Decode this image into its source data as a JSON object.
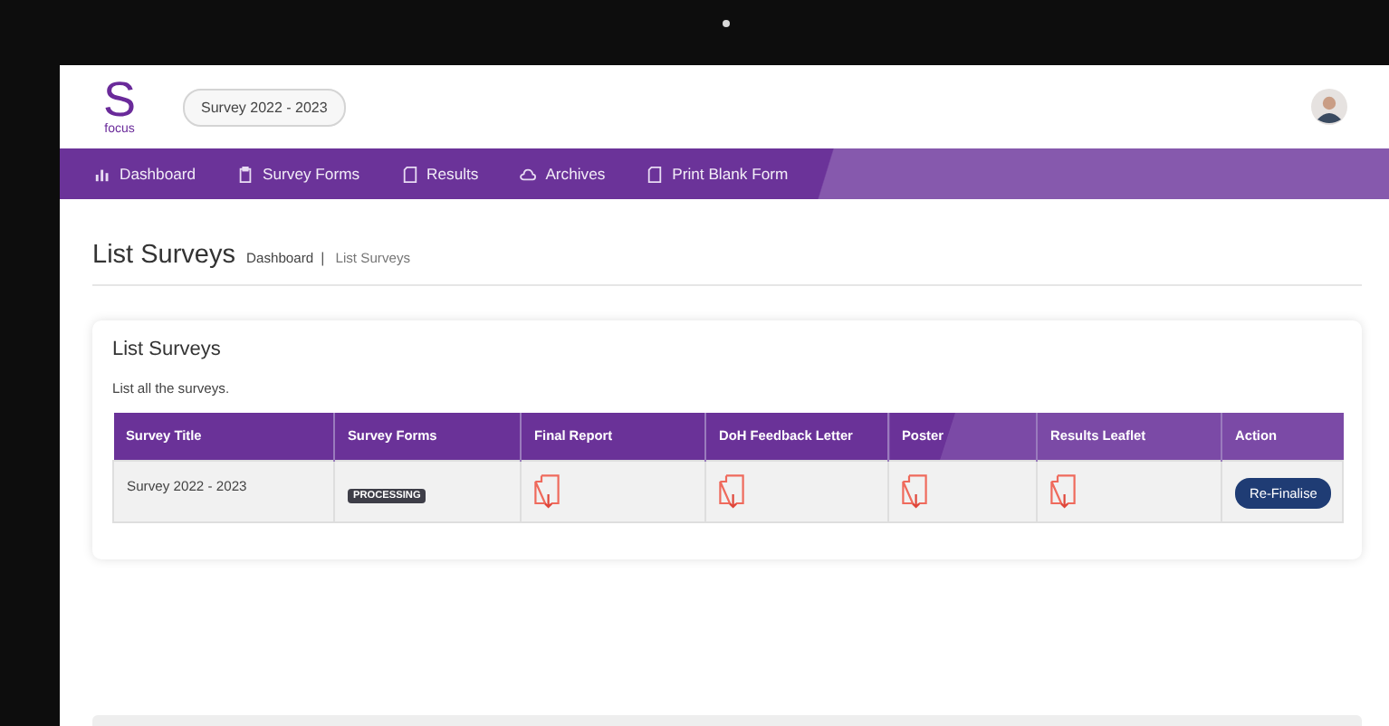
{
  "header": {
    "logo": {
      "letter": "S",
      "caption": "focus"
    },
    "survey_selector": "Survey 2022 - 2023"
  },
  "nav": [
    {
      "label": "Dashboard",
      "kind": "chart"
    },
    {
      "label": "Survey Forms",
      "kind": "clipboard"
    },
    {
      "label": "Results",
      "kind": "document"
    },
    {
      "label": "Archives",
      "kind": "cloud"
    },
    {
      "label": "Print Blank Form",
      "kind": "document"
    }
  ],
  "page": {
    "title": "List Surveys",
    "breadcrumb": [
      "Dashboard",
      "List Surveys"
    ],
    "separator": "|"
  },
  "card": {
    "title": "List Surveys",
    "description": "List all the surveys.",
    "table": {
      "columns": [
        "Survey Title",
        "Survey Forms",
        "Final Report",
        "DoH Feedback Letter",
        "Poster",
        "Results Leaflet",
        "Action"
      ],
      "rows": [
        [
          {
            "kind": "text",
            "text": "Survey 2022 - 2023"
          },
          {
            "kind": "badge",
            "text": "PROCESSING"
          },
          {
            "kind": "file"
          },
          {
            "kind": "file"
          },
          {
            "kind": "file"
          },
          {
            "kind": "file"
          },
          {
            "kind": "button",
            "text": "Re-Finalise"
          }
        ]
      ]
    }
  }
}
